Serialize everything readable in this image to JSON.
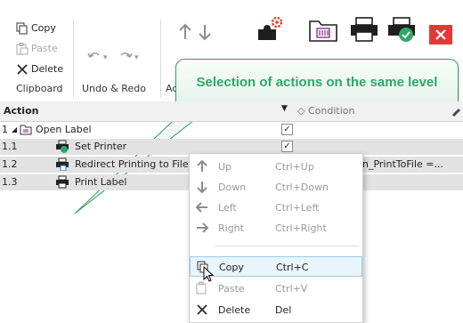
{
  "ribbon": {
    "clipboard": {
      "copy": "Copy",
      "paste": "Paste",
      "delete": "Delete",
      "group": "Clipboard"
    },
    "undo_group": "Undo & Redo",
    "action_group_partial": "Ac",
    "colors": {
      "red_button": "#e53935",
      "green_badge": "#2fa768",
      "arrow_gray": "#8c8c8c"
    }
  },
  "callout": {
    "text": "Selection of actions on the same level"
  },
  "table": {
    "header": {
      "action": "Action",
      "condition": "Condition"
    },
    "rows": [
      {
        "num": "1",
        "label": "Open Label",
        "checked": true
      },
      {
        "num": "1.1",
        "label": "Set Printer",
        "checked": true
      },
      {
        "num": "1.2",
        "label": "Redirect Printing to File",
        "checked": false,
        "condition": "n_PrintToFile =..."
      },
      {
        "num": "1.3",
        "label": "Print Label",
        "checked": false
      }
    ]
  },
  "context_menu": {
    "items": [
      {
        "label": "Up",
        "shortcut": "Ctrl+Up",
        "icon": "arrow-up-icon"
      },
      {
        "label": "Down",
        "shortcut": "Ctrl+Down",
        "icon": "arrow-down-icon"
      },
      {
        "label": "Left",
        "shortcut": "Ctrl+Left",
        "icon": "arrow-left-icon"
      },
      {
        "label": "Right",
        "shortcut": "Ctrl+Right",
        "icon": "arrow-right-icon"
      },
      {
        "label": "Copy",
        "shortcut": "Ctrl+C",
        "icon": "copy-icon"
      },
      {
        "label": "Paste",
        "shortcut": "Ctrl+V",
        "icon": "paste-icon"
      },
      {
        "label": "Delete",
        "shortcut": "Del",
        "icon": "delete-icon"
      }
    ]
  }
}
